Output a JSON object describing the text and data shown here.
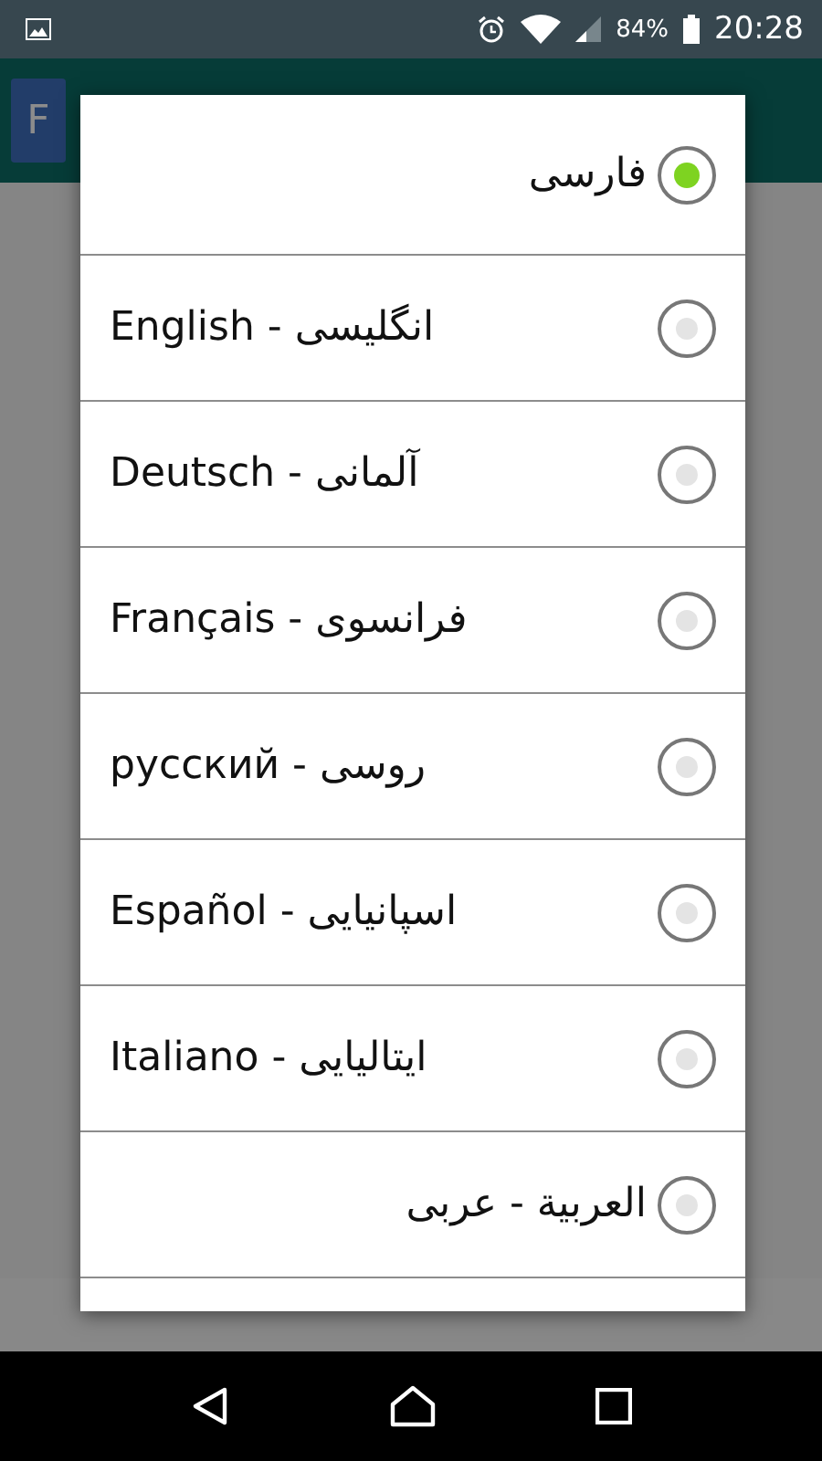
{
  "status_bar": {
    "battery": "84%",
    "time": "20:28"
  },
  "app_bar": {
    "logo": "F"
  },
  "dialog": {
    "options": [
      {
        "label": "فارسی",
        "kind": "rtl",
        "selected": true
      },
      {
        "label": "English - انگلیسی",
        "kind": "ltr",
        "selected": false
      },
      {
        "label": "Deutsch - آلمانی",
        "kind": "ltr",
        "selected": false
      },
      {
        "label": "Français - فرانسوی",
        "kind": "ltr",
        "selected": false
      },
      {
        "label": "русский - روسی",
        "kind": "ltr",
        "selected": false
      },
      {
        "label": "Español - اسپانیایی",
        "kind": "ltr",
        "selected": false
      },
      {
        "label": "Italiano - ایتالیایی",
        "kind": "ltr",
        "selected": false
      },
      {
        "label": "العربية - عربی",
        "kind": "rtl",
        "selected": false
      }
    ]
  }
}
